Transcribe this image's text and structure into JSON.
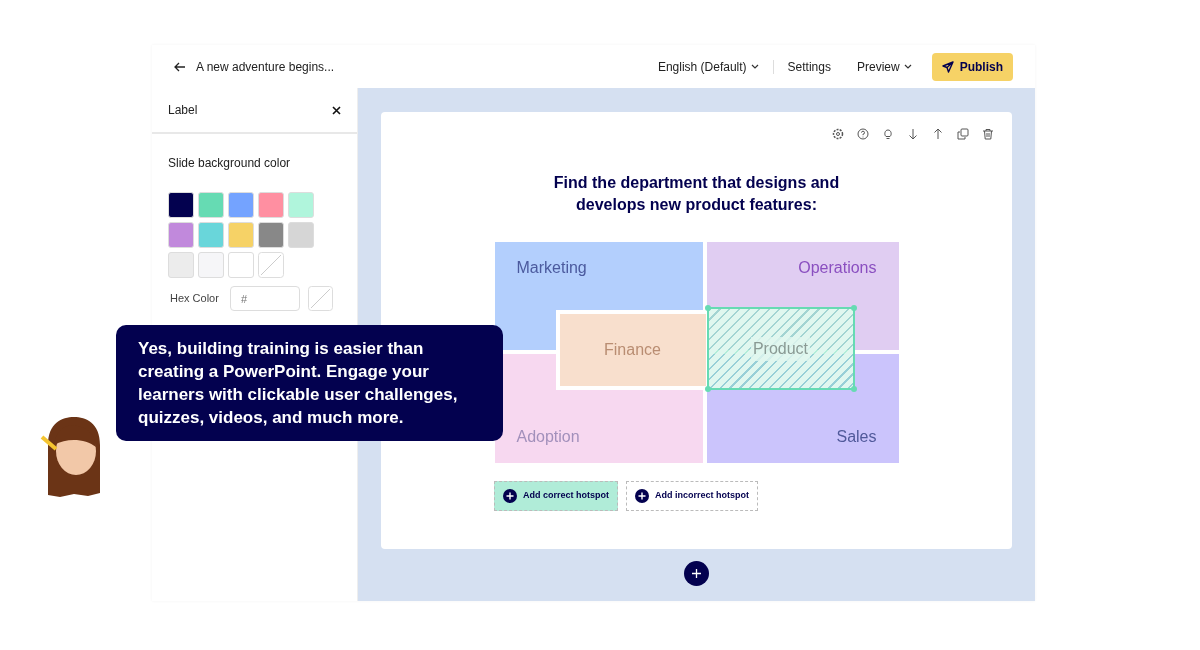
{
  "header": {
    "back_title": "A new adventure begins...",
    "language": "English (Default)",
    "settings": "Settings",
    "preview": "Preview",
    "publish": "Publish"
  },
  "panel": {
    "title": "Label",
    "section": "Slide background color",
    "swatches": [
      {
        "kind": "color",
        "color": "#03014f"
      },
      {
        "kind": "color",
        "color": "#66dbb3"
      },
      {
        "kind": "color",
        "color": "#74a3ff"
      },
      {
        "kind": "color",
        "color": "#ff8fa1"
      },
      {
        "kind": "color",
        "color": "#b0f5dc"
      },
      {
        "kind": "color",
        "color": "#c189dc"
      },
      {
        "kind": "color",
        "color": "#69d6da"
      },
      {
        "kind": "color",
        "color": "#f6d266"
      },
      {
        "kind": "color",
        "color": "#888888"
      },
      {
        "kind": "color",
        "color": "#d6d6d6"
      },
      {
        "kind": "color",
        "color": "#ececec"
      },
      {
        "kind": "color",
        "color": "#f6f6f8"
      },
      {
        "kind": "color",
        "color": "#ffffff"
      },
      {
        "kind": "none"
      }
    ],
    "hex_label": "Hex Color",
    "hex_placeholder": "#"
  },
  "slide": {
    "question": "Find the department that designs and develops new product features:",
    "regions": [
      {
        "kind": "quadrant",
        "label": "Marketing",
        "color": "#b3cffd"
      },
      {
        "kind": "quadrant",
        "label": "Operations",
        "color": "#e0cdf2"
      },
      {
        "kind": "quadrant",
        "label": "Adoption",
        "color": "#f7d8f0"
      },
      {
        "kind": "quadrant",
        "label": "Sales",
        "color": "#cbc4fc"
      },
      {
        "kind": "center",
        "label": "Finance",
        "color": "#f8dfcd"
      },
      {
        "kind": "hotspot",
        "label": "Product",
        "color": "#66dbb3"
      }
    ],
    "buttons": [
      {
        "kind": "correct",
        "label": "Add correct hotspot"
      },
      {
        "kind": "incorrect",
        "label": "Add incorrect hotspot"
      }
    ]
  },
  "tooltip": "Yes, building training is easier than creating a PowerPoint. Engage your learners with clickable user challenges, quizzes, videos, and much more."
}
